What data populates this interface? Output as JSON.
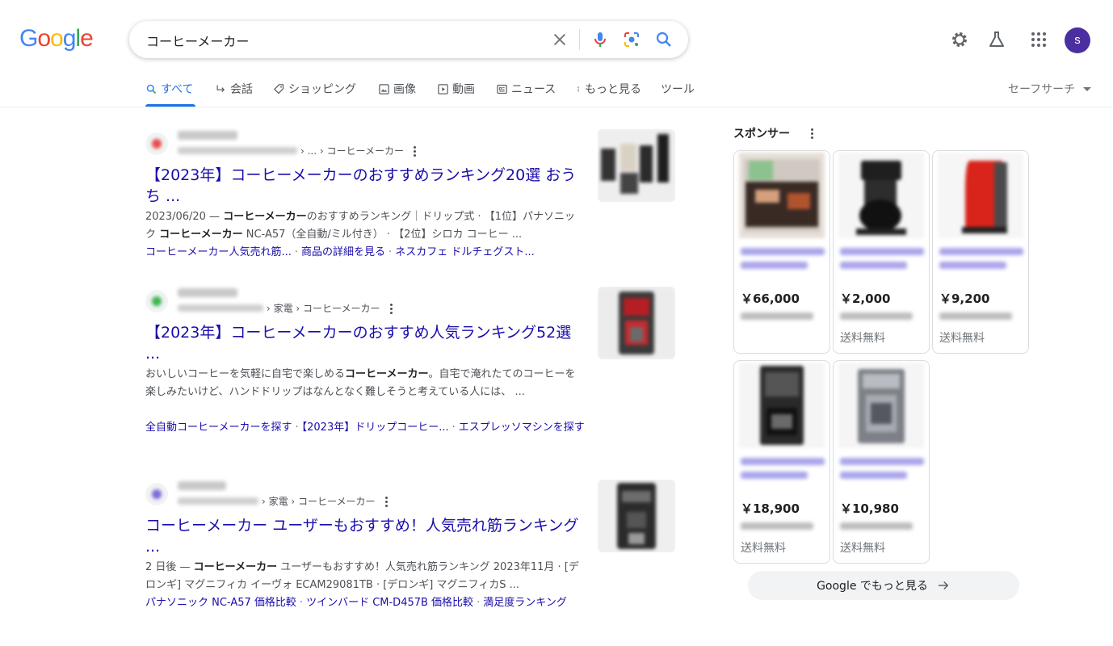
{
  "logo": "Google",
  "search": {
    "query": "コーヒーメーカー"
  },
  "user": {
    "avatar_letter": "s"
  },
  "tabs": [
    {
      "label": "すべて",
      "icon": "search-icon"
    },
    {
      "label": "会話",
      "icon": "reply-arrow-icon"
    },
    {
      "label": "ショッピング",
      "icon": "tag-icon"
    },
    {
      "label": "画像",
      "icon": "image-icon"
    },
    {
      "label": "動画",
      "icon": "play-icon"
    },
    {
      "label": "ニュース",
      "icon": "news-icon"
    },
    {
      "label": "もっと見る",
      "icon": "more-vert-icon"
    },
    {
      "label": "ツール"
    }
  ],
  "safesearch": "セーフサーチ",
  "results": [
    {
      "breadcrumb": "› ... › コーヒーメーカー",
      "title": "【2023年】コーヒーメーカーのおすすめランキング20選 おうち ...",
      "snippet_prefix": "2023/06/20 — ",
      "snippet_bold1": "コーヒーメーカー",
      "snippet_mid": "のおすすめランキング｜ドリップ式 · 【1位】パナソニック ",
      "snippet_bold2": "コーヒーメーカー",
      "snippet_tail": " NC-A57（全自動/ミル付き） · 【2位】シロカ コーヒー ...",
      "links": [
        "コーヒーメーカー人気売れ筋...",
        "商品の詳細を見る",
        "ネスカフェ ドルチェグスト..."
      ]
    },
    {
      "breadcrumb": "› 家電 › コーヒーメーカー",
      "title": "【2023年】コーヒーメーカーのおすすめ人気ランキング52選 ...",
      "snippet_prefix": "おいしいコーヒーを気軽に自宅で楽しめる",
      "snippet_bold1": "コーヒーメーカー",
      "snippet_mid": "。自宅で淹れたてのコーヒーを楽しみたいけど、ハンドドリップはなんとなく難しそうと考えている人には、 ...",
      "snippet_bold2": "",
      "snippet_tail": "",
      "links": [
        "全自動コーヒーメーカーを探す",
        "【2023年】ドリップコーヒー...",
        "エスプレッソマシンを探す"
      ]
    },
    {
      "breadcrumb": "› 家電 › コーヒーメーカー",
      "title": "コーヒーメーカー ユーザーもおすすめ！人気売れ筋ランキング ...",
      "snippet_prefix": "2 日後 — ",
      "snippet_bold1": "コーヒーメーカー",
      "snippet_mid": " ユーザーもおすすめ！人気売れ筋ランキング 2023年11月 · [デロンギ] マグニフィカ イーヴォ ECAM29081TB · [デロンギ] マグニフィカS ...",
      "snippet_bold2": "",
      "snippet_tail": "",
      "links": [
        "パナソニック NC-A57 価格比較",
        "ツインバード CM-D457B 価格比較",
        "満足度ランキング"
      ]
    }
  ],
  "sponsored": {
    "heading": "スポンサー",
    "products": [
      {
        "price": "￥66,000",
        "shipping": "",
        "image": "coffee-machine-red-panel",
        "accent": "#7a3a1c"
      },
      {
        "price": "￥2,000",
        "shipping": "送料無料",
        "image": "black-drip-coffee-maker",
        "accent": "#1f1f1f"
      },
      {
        "price": "￥9,200",
        "shipping": "送料無料",
        "image": "red-capsule-machine",
        "accent": "#d8241b"
      },
      {
        "price": "￥18,900",
        "shipping": "送料無料",
        "image": "black-coffee-maker",
        "accent": "#2a2a2a"
      },
      {
        "price": "￥10,980",
        "shipping": "送料無料",
        "image": "silver-coffee-maker",
        "accent": "#8a8d93"
      }
    ],
    "more_label": "Google でもっと見る"
  },
  "colors": {
    "link": "#1a0dab",
    "accent": "#1a73e8",
    "avatar": "#4a2fa0"
  }
}
